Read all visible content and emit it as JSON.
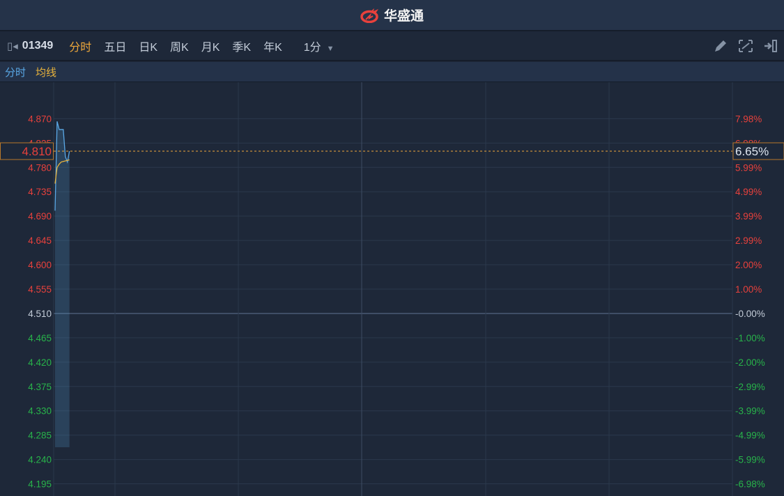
{
  "app": {
    "title": "华盛通"
  },
  "toolbar": {
    "code": "01349",
    "tabs": [
      "分时",
      "五日",
      "日K",
      "周K",
      "月K",
      "季K",
      "年K"
    ],
    "active_tab": "分时",
    "period": "1分"
  },
  "legend": {
    "price": "分时",
    "avg": "均线"
  },
  "current": {
    "price": "4.810",
    "change": "6.65%"
  },
  "colors": {
    "up": "#e8413c",
    "down": "#28b34a",
    "neutral": "#c3ccd8",
    "price_line": "#5aa8e6",
    "avg_line": "#e8b33c",
    "accent": "#f0a93a"
  },
  "chart_data": {
    "type": "line",
    "title": "",
    "prev_close": 4.51,
    "ylim": [
      4.1725,
      4.9375
    ],
    "y_ticks": [
      "4.870",
      "4.825",
      "4.780",
      "4.735",
      "4.690",
      "4.645",
      "4.600",
      "4.555",
      "4.510",
      "4.465",
      "4.420",
      "4.375",
      "4.330",
      "4.285",
      "4.240",
      "4.195"
    ],
    "y_tick_values": [
      4.87,
      4.825,
      4.78,
      4.735,
      4.69,
      4.645,
      4.6,
      4.555,
      4.51,
      4.465,
      4.42,
      4.375,
      4.33,
      4.285,
      4.24,
      4.195
    ],
    "pct_ticks": [
      "7.98%",
      "6.98%",
      "5.99%",
      "4.99%",
      "3.99%",
      "2.99%",
      "2.00%",
      "1.00%",
      "-0.00%",
      "-1.00%",
      "-2.00%",
      "-2.99%",
      "-3.99%",
      "-4.99%",
      "-5.99%",
      "-6.98%"
    ],
    "minutes_total": 330,
    "series": [
      {
        "name": "分时",
        "values": [
          4.7,
          4.865,
          4.85,
          4.85,
          4.85,
          4.8,
          4.79,
          4.81
        ]
      },
      {
        "name": "均线",
        "values": [
          4.75,
          4.78,
          4.786,
          4.79,
          4.791,
          4.792,
          4.793,
          4.794
        ]
      }
    ]
  }
}
